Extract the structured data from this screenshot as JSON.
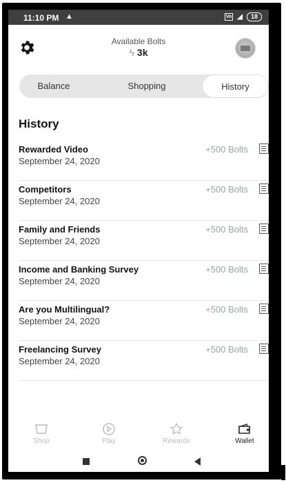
{
  "statusbar": {
    "time": "11:10 PM",
    "warning_icon": "warning-icon",
    "battery": "18",
    "volte": "Vo"
  },
  "header": {
    "available_label": "Available Bolts",
    "bolts_value": "3k"
  },
  "tabs": [
    {
      "label": "Balance",
      "selected": false
    },
    {
      "label": "Shopping",
      "selected": false
    },
    {
      "label": "History",
      "selected": true
    }
  ],
  "history": {
    "title": "History",
    "items": [
      {
        "name": "Rewarded Video",
        "date": "September 24, 2020",
        "amount": "+500 Bolts"
      },
      {
        "name": "Competitors",
        "date": "September 24, 2020",
        "amount": "+500 Bolts"
      },
      {
        "name": "Family and Friends",
        "date": "September 24, 2020",
        "amount": "+500 Bolts"
      },
      {
        "name": "Income and Banking Survey",
        "date": "September 24, 2020",
        "amount": "+500 Bolts"
      },
      {
        "name": "Are you Multilingual?",
        "date": "September 24, 2020",
        "amount": "+500 Bolts"
      },
      {
        "name": "Freelancing Survey",
        "date": "September 24, 2020",
        "amount": "+500 Bolts"
      }
    ]
  },
  "bottom_nav": [
    {
      "label": "Shop",
      "icon": "shop-icon",
      "active": false
    },
    {
      "label": "Play",
      "icon": "play-icon",
      "active": false
    },
    {
      "label": "Rewards",
      "icon": "star-icon",
      "active": false
    },
    {
      "label": "Wallet",
      "icon": "wallet-icon",
      "active": true
    }
  ],
  "colors": {
    "amount": "#9aa3a3",
    "inactive_nav": "#bbbbbb",
    "active_nav": "#222222"
  }
}
